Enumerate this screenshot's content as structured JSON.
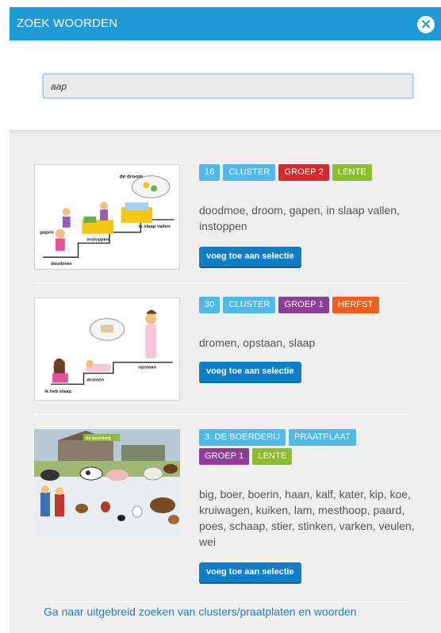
{
  "header": {
    "title": "ZOEK WOORDEN",
    "close_label": "×"
  },
  "search": {
    "value": "aap"
  },
  "results": [
    {
      "badges": [
        "16",
        "CLUSTER",
        "GROEP 2",
        "LENTE"
      ],
      "words": "doodmoe, droom, gapen, in slaap vallen, instoppen",
      "button": "voeg toe aan selectie",
      "image_labels": [
        "de droom",
        "gapen",
        "in slaap vallen",
        "instoppen",
        "doodmoe"
      ]
    },
    {
      "badges": [
        "30",
        "CLUSTER",
        "GROEP 1",
        "HERFST"
      ],
      "words": "dromen, opstaan, slaap",
      "button": "voeg toe aan selectie",
      "image_labels": [
        "opstaan",
        "dromen",
        "ik heb slaap"
      ]
    },
    {
      "badges": [
        "3. DE BOERDERIJ",
        "PRAATPLAAT",
        "GROEP 1",
        "LENTE"
      ],
      "words": "big, boer, boerin, haan, kalf, kater, kip, koe, kruiwagen, kuiken, lam, mesthoop, paard, poes, schaap, stier, stinken, varken, veulen, wei",
      "button": "voeg toe aan selectie",
      "image_labels": [
        "de boerderij"
      ]
    }
  ],
  "footer": {
    "link": "Ga naar uitgebreid zoeken van clusters/praatplaten en woorden"
  },
  "colors": {
    "header": "#1f9ad6",
    "badge_blue": "#4fb9ea",
    "groep2": "#d9262f",
    "groep1": "#8f3c9a",
    "lente": "#8dbc2c",
    "herfst": "#ec5f1d",
    "button": "#0d7fc9"
  }
}
